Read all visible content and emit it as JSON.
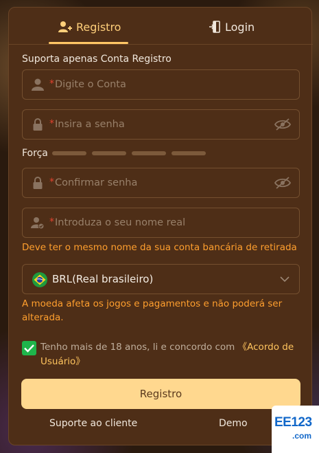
{
  "tabs": {
    "registro": "Registro",
    "login": "Login"
  },
  "support_note": "Suporta apenas Conta Registro",
  "fields": {
    "account": {
      "required": "*",
      "placeholder": "Digite o Conta"
    },
    "password": {
      "required": "*",
      "placeholder": "Insira a senha"
    },
    "confirm_password": {
      "required": "*",
      "placeholder": "Confirmar senha"
    },
    "real_name": {
      "required": "*",
      "placeholder": "Introduza o seu nome real"
    }
  },
  "strength": {
    "label": "Força",
    "level": 0,
    "segments": 4
  },
  "real_name_warning": "Deve ter o mesmo nome da sua conta bancária de retirada",
  "currency": {
    "selected": "BRL(Real brasileiro)",
    "flag": "brazil-flag",
    "warning": "A moeda afeta os jogos e pagamentos e não poderá ser alterada."
  },
  "agreement": {
    "checked": true,
    "text": "Tenho mais de 18 anos, li e concordo com ",
    "link": "《Acordo de Usuário》"
  },
  "submit_label": "Registro",
  "footer": {
    "support": "Suporte ao cliente",
    "demo": "Demo"
  },
  "watermark": {
    "top": "EE123",
    "bottom": ".com"
  },
  "colors": {
    "accent": "#ffc766",
    "panel": "#4e2e17",
    "warning": "#ff9f2e",
    "required": "#e0432f",
    "check": "#1fb54b"
  }
}
